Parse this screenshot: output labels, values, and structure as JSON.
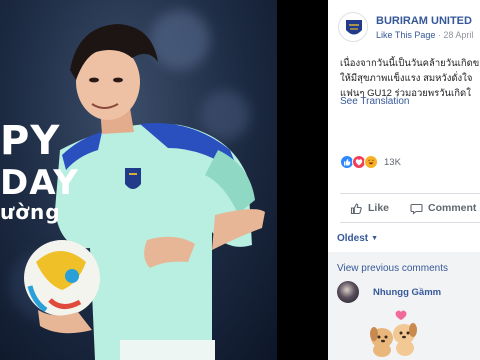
{
  "photo": {
    "greeting_line1": "PY",
    "greeting_line2": "DAY",
    "greeting_line3": "ường"
  },
  "post": {
    "page_name": "BURIRAM UNITED",
    "like_this_page": "Like This Page",
    "meta_separator": " · ",
    "date": "28 April",
    "body_lines": [
      "เนื่องจากวันนี้เป็นวันคล้ายวันเกิดข",
      "ให้มีสุขภาพแข็งแรง สมหวังดั่งใจ",
      "แฟนๆ GU12 ร่วมอวยพรวันเกิดใ"
    ],
    "see_translation": "See Translation",
    "reaction_count": "13K",
    "reactions": [
      "like-icon",
      "love-icon",
      "haha-icon"
    ],
    "like_label": "Like",
    "comment_label": "Comment",
    "sort_label": "Oldest",
    "view_previous": "View previous comments",
    "commenter_name": "Nhungg Gầmm"
  },
  "colors": {
    "link_blue": "#365899",
    "like_blue": "#2d88ff",
    "love_red": "#f33e58",
    "haha_yellow": "#f7b125",
    "jersey_mint": "#b8efe0",
    "jersey_blue": "#2a4fbf"
  }
}
